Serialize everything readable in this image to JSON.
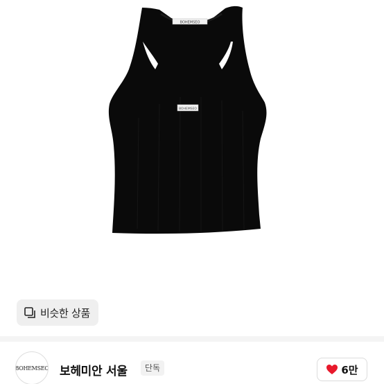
{
  "product": {
    "image_alt": "black tank top",
    "neck_label_text": "BOHEMSEO",
    "front_label_text": "BOHEMSEO"
  },
  "similar_button": {
    "label": "비슷한 상품",
    "icon": "similar-items-icon"
  },
  "seller": {
    "logo_text": "BOHEMSEO",
    "name": "보헤미안 서울",
    "badge": "단독"
  },
  "like": {
    "icon": "heart-icon",
    "count": "6만",
    "color": "#e8192c"
  }
}
